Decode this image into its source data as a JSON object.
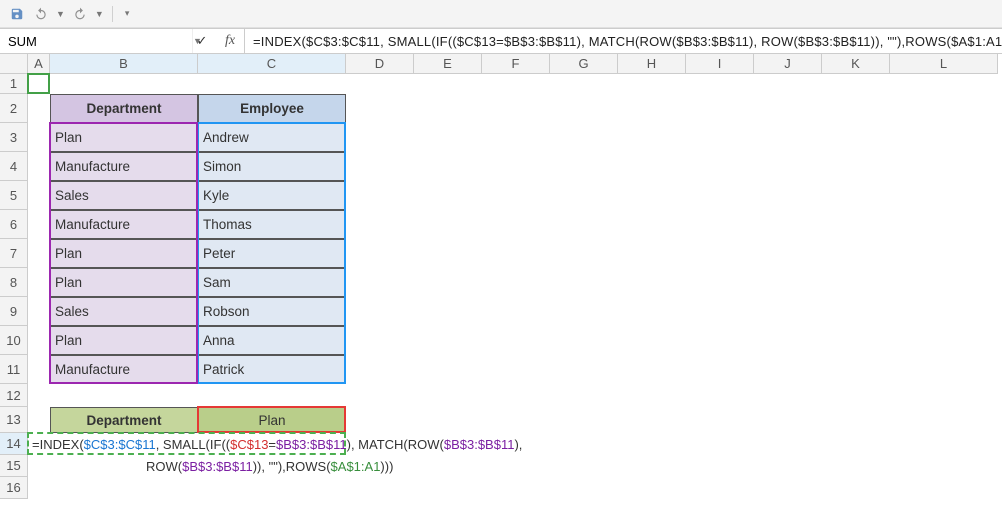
{
  "qat": {
    "save": "Save",
    "undo": "Undo",
    "redo": "Redo"
  },
  "nameBox": "SUM",
  "fbarButtons": {
    "cancel": "✕",
    "enter": "✓",
    "fx": "fx"
  },
  "formula": "=INDEX($C$3:$C$11, SMALL(IF(($C$13=$B$3:$B$11), MATCH(ROW($B$3:$B$11), ROW($B$3:$B$11)), \"\"),ROWS($A$1:A1)))",
  "colWidths": {
    "A": 22,
    "B": 148,
    "C": 148,
    "D": 68,
    "E": 68,
    "F": 68,
    "G": 68,
    "H": 68,
    "I": 68,
    "J": 68,
    "K": 68,
    "L": 108
  },
  "rowHeights": {
    "default": 29,
    "r1": 20,
    "r12": 23,
    "r13": 26,
    "r14": 22,
    "r15": 22,
    "r16": 22
  },
  "columns": [
    "A",
    "B",
    "C",
    "D",
    "E",
    "F",
    "G",
    "H",
    "I",
    "J",
    "K",
    "L"
  ],
  "rows": [
    1,
    2,
    3,
    4,
    5,
    6,
    7,
    8,
    9,
    10,
    11,
    12,
    13,
    14,
    15,
    16
  ],
  "table": {
    "headers": {
      "dept": "Department",
      "emp": "Employee"
    },
    "rows": [
      {
        "dept": "Plan",
        "emp": "Andrew"
      },
      {
        "dept": "Manufacture",
        "emp": "Simon"
      },
      {
        "dept": "Sales",
        "emp": "Kyle"
      },
      {
        "dept": "Manufacture",
        "emp": "Thomas"
      },
      {
        "dept": "Plan",
        "emp": "Peter"
      },
      {
        "dept": "Plan",
        "emp": "Sam"
      },
      {
        "dept": "Sales",
        "emp": "Robson"
      },
      {
        "dept": "Plan",
        "emp": "Anna"
      },
      {
        "dept": "Manufacture",
        "emp": "Patrick"
      }
    ]
  },
  "lookup": {
    "label": "Department",
    "value": "Plan"
  },
  "cellFormula": {
    "p1": "=INDEX(",
    "p2": "$C$3:$C$11",
    "p3": ", SMALL(IF((",
    "p4": "$C$13",
    "p5": "=",
    "p6": "$B$3:$B$11",
    "p7": "), MATCH(ROW(",
    "p8": "$B$3:$B$11",
    "p9": "),",
    "line2a": "ROW(",
    "line2b": "$B$3:$B$11",
    "line2c": ")), \"\"),ROWS(",
    "line2d": "$A$1:A1",
    "line2e": ")))"
  }
}
